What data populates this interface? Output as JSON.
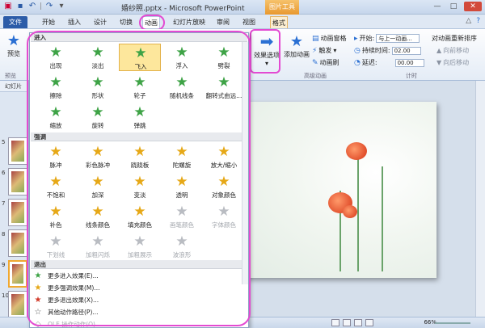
{
  "titlebar": {
    "title": "婚纱照.pptx - Microsoft PowerPoint",
    "context_tool": "图片工具"
  },
  "tabs": {
    "file": "文件",
    "items": [
      "开始",
      "插入",
      "设计",
      "切换",
      "动画",
      "幻灯片放映",
      "审阅",
      "视图",
      "格式"
    ]
  },
  "ribbon": {
    "preview": "预览",
    "preview_group": "预览",
    "effect_options": "效果选项",
    "add_animation": "添加动画",
    "animation_pane": "动画窗格",
    "trigger": "触发",
    "animation_painter": "动画刷",
    "advanced_group": "高级动画",
    "start_label": "开始:",
    "start_value": "与上一动画...",
    "duration_label": "持续时间:",
    "duration_value": "02.00",
    "delay_label": "延迟:",
    "delay_value": "00.00",
    "timing_group": "计时",
    "reorder_title": "对动画重新排序",
    "move_earlier": "向前移动",
    "move_later": "向后移动"
  },
  "leftpanel": {
    "header": "幻灯片",
    "numbers": [
      "",
      "5",
      "6",
      "7",
      "8",
      "9",
      "10",
      "11"
    ]
  },
  "statusbar": {
    "zoom": "66%"
  },
  "gallery": {
    "entrance_header": "进入",
    "entrance": [
      {
        "label": "出现",
        "icon": "star-appear-icon"
      },
      {
        "label": "淡出",
        "icon": "star-fade-icon"
      },
      {
        "label": "飞入",
        "icon": "star-flyin-icon"
      },
      {
        "label": "浮入",
        "icon": "star-floatin-icon"
      },
      {
        "label": "劈裂",
        "icon": "star-split-icon"
      },
      {
        "label": "擦除",
        "icon": "star-wipe-icon"
      },
      {
        "label": "形状",
        "icon": "star-shape-icon"
      },
      {
        "label": "轮子",
        "icon": "star-wheel-icon"
      },
      {
        "label": "随机线条",
        "icon": "star-randombars-icon"
      },
      {
        "label": "翻转式由远...",
        "icon": "star-growturn-icon"
      },
      {
        "label": "缩放",
        "icon": "star-zoom-icon"
      },
      {
        "label": "旋转",
        "icon": "star-swivel-icon"
      },
      {
        "label": "弹跳",
        "icon": "star-bounce-icon"
      }
    ],
    "emphasis_header": "强调",
    "emphasis": [
      {
        "label": "脉冲",
        "icon": "star-pulse-icon"
      },
      {
        "label": "彩色脉冲",
        "icon": "star-colorpulse-icon"
      },
      {
        "label": "跷跷板",
        "icon": "star-teeter-icon"
      },
      {
        "label": "陀螺旋",
        "icon": "star-spin-icon"
      },
      {
        "label": "放大/缩小",
        "icon": "star-growshrink-icon"
      },
      {
        "label": "不饱和",
        "icon": "star-desaturate-icon"
      },
      {
        "label": "加深",
        "icon": "star-darken-icon"
      },
      {
        "label": "变淡",
        "icon": "star-lighten-icon"
      },
      {
        "label": "透明",
        "icon": "star-transparency-icon"
      },
      {
        "label": "对象颜色",
        "icon": "star-objectcolor-icon"
      },
      {
        "label": "补色",
        "icon": "star-complementary-icon"
      },
      {
        "label": "线条颜色",
        "icon": "star-linecolor-icon"
      },
      {
        "label": "填充颜色",
        "icon": "star-fillcolor-icon"
      },
      {
        "label": "画笔颜色",
        "icon": "star-brushcolor-icon"
      },
      {
        "label": "字体颜色",
        "icon": "star-fontcolor-icon"
      },
      {
        "label": "下划线",
        "icon": "star-underline-icon"
      },
      {
        "label": "加粗闪烁",
        "icon": "star-boldflash-icon"
      },
      {
        "label": "加粗展示",
        "icon": "star-boldreveal-icon"
      },
      {
        "label": "波浪形",
        "icon": "star-wave-icon"
      }
    ],
    "exit_header": "退出",
    "menu": [
      {
        "label": "更多进入效果(E)...",
        "icon": "star-green-icon"
      },
      {
        "label": "更多强调效果(M)...",
        "icon": "star-yellow-icon"
      },
      {
        "label": "更多退出效果(X)...",
        "icon": "star-red-icon"
      },
      {
        "label": "其他动作路径(P)...",
        "icon": "star-outline-icon"
      },
      {
        "label": "OLE 操作动作(O)...",
        "icon": "ole-icon"
      }
    ]
  }
}
